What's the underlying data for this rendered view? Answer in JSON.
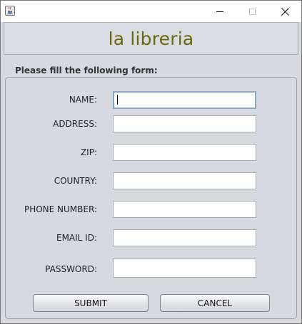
{
  "window": {
    "app_icon": "java-cup-icon",
    "controls": {
      "minimize_icon": "minimize-icon",
      "maximize_icon": "maximize-icon",
      "close_icon": "close-icon"
    }
  },
  "header": {
    "title": "la libreria",
    "title_color": "#69690c"
  },
  "form": {
    "caption": "Please fill the following form:",
    "fields": [
      {
        "label": "NAME:",
        "value": ""
      },
      {
        "label": "ADDRESS:",
        "value": ""
      },
      {
        "label": "ZIP:",
        "value": ""
      },
      {
        "label": "COUNTRY:",
        "value": ""
      },
      {
        "label": "PHONE NUMBER:",
        "value": ""
      },
      {
        "label": "EMAIL ID:",
        "value": ""
      },
      {
        "label": "PASSWORD:",
        "value": ""
      }
    ],
    "submit_label": "SUBMIT",
    "cancel_label": "CANCEL"
  }
}
